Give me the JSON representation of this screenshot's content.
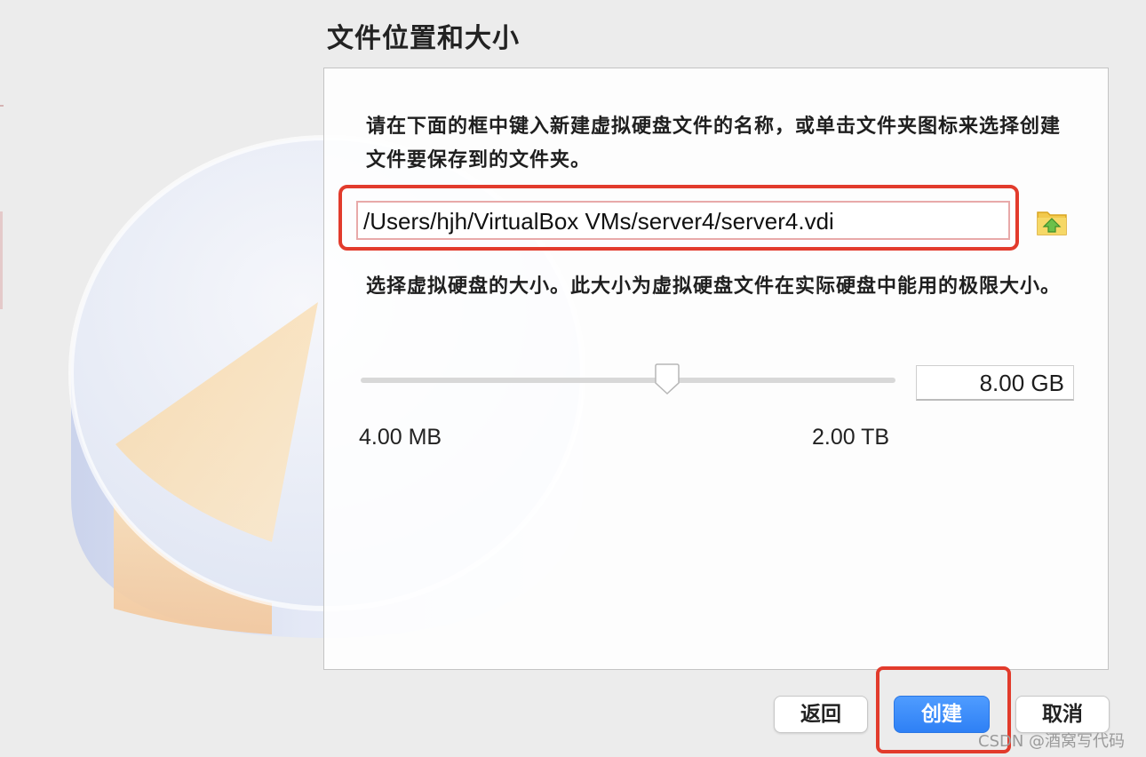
{
  "header": {
    "title": "文件位置和大小"
  },
  "location": {
    "description": "请在下面的框中键入新建虚拟硬盘文件的名称，或单击文件夹图标来选择创建文件要保存到的文件夹。",
    "path_value": "/Users/hjh/VirtualBox VMs/server4/server4.vdi",
    "folder_icon": "folder-open-icon"
  },
  "size": {
    "description": "选择虚拟硬盘的大小。此大小为虚拟硬盘文件在实际硬盘中能用的极限大小。",
    "value": "8.00 GB",
    "min_label": "4.00 MB",
    "max_label": "2.00 TB"
  },
  "buttons": {
    "back": "返回",
    "create": "创建",
    "cancel": "取消"
  },
  "watermark": "CSDN @酒窝写代码",
  "colors": {
    "highlight": "#e23b2c",
    "primary_button": "#2e80f5",
    "pie_accent": "#f6cf93"
  }
}
